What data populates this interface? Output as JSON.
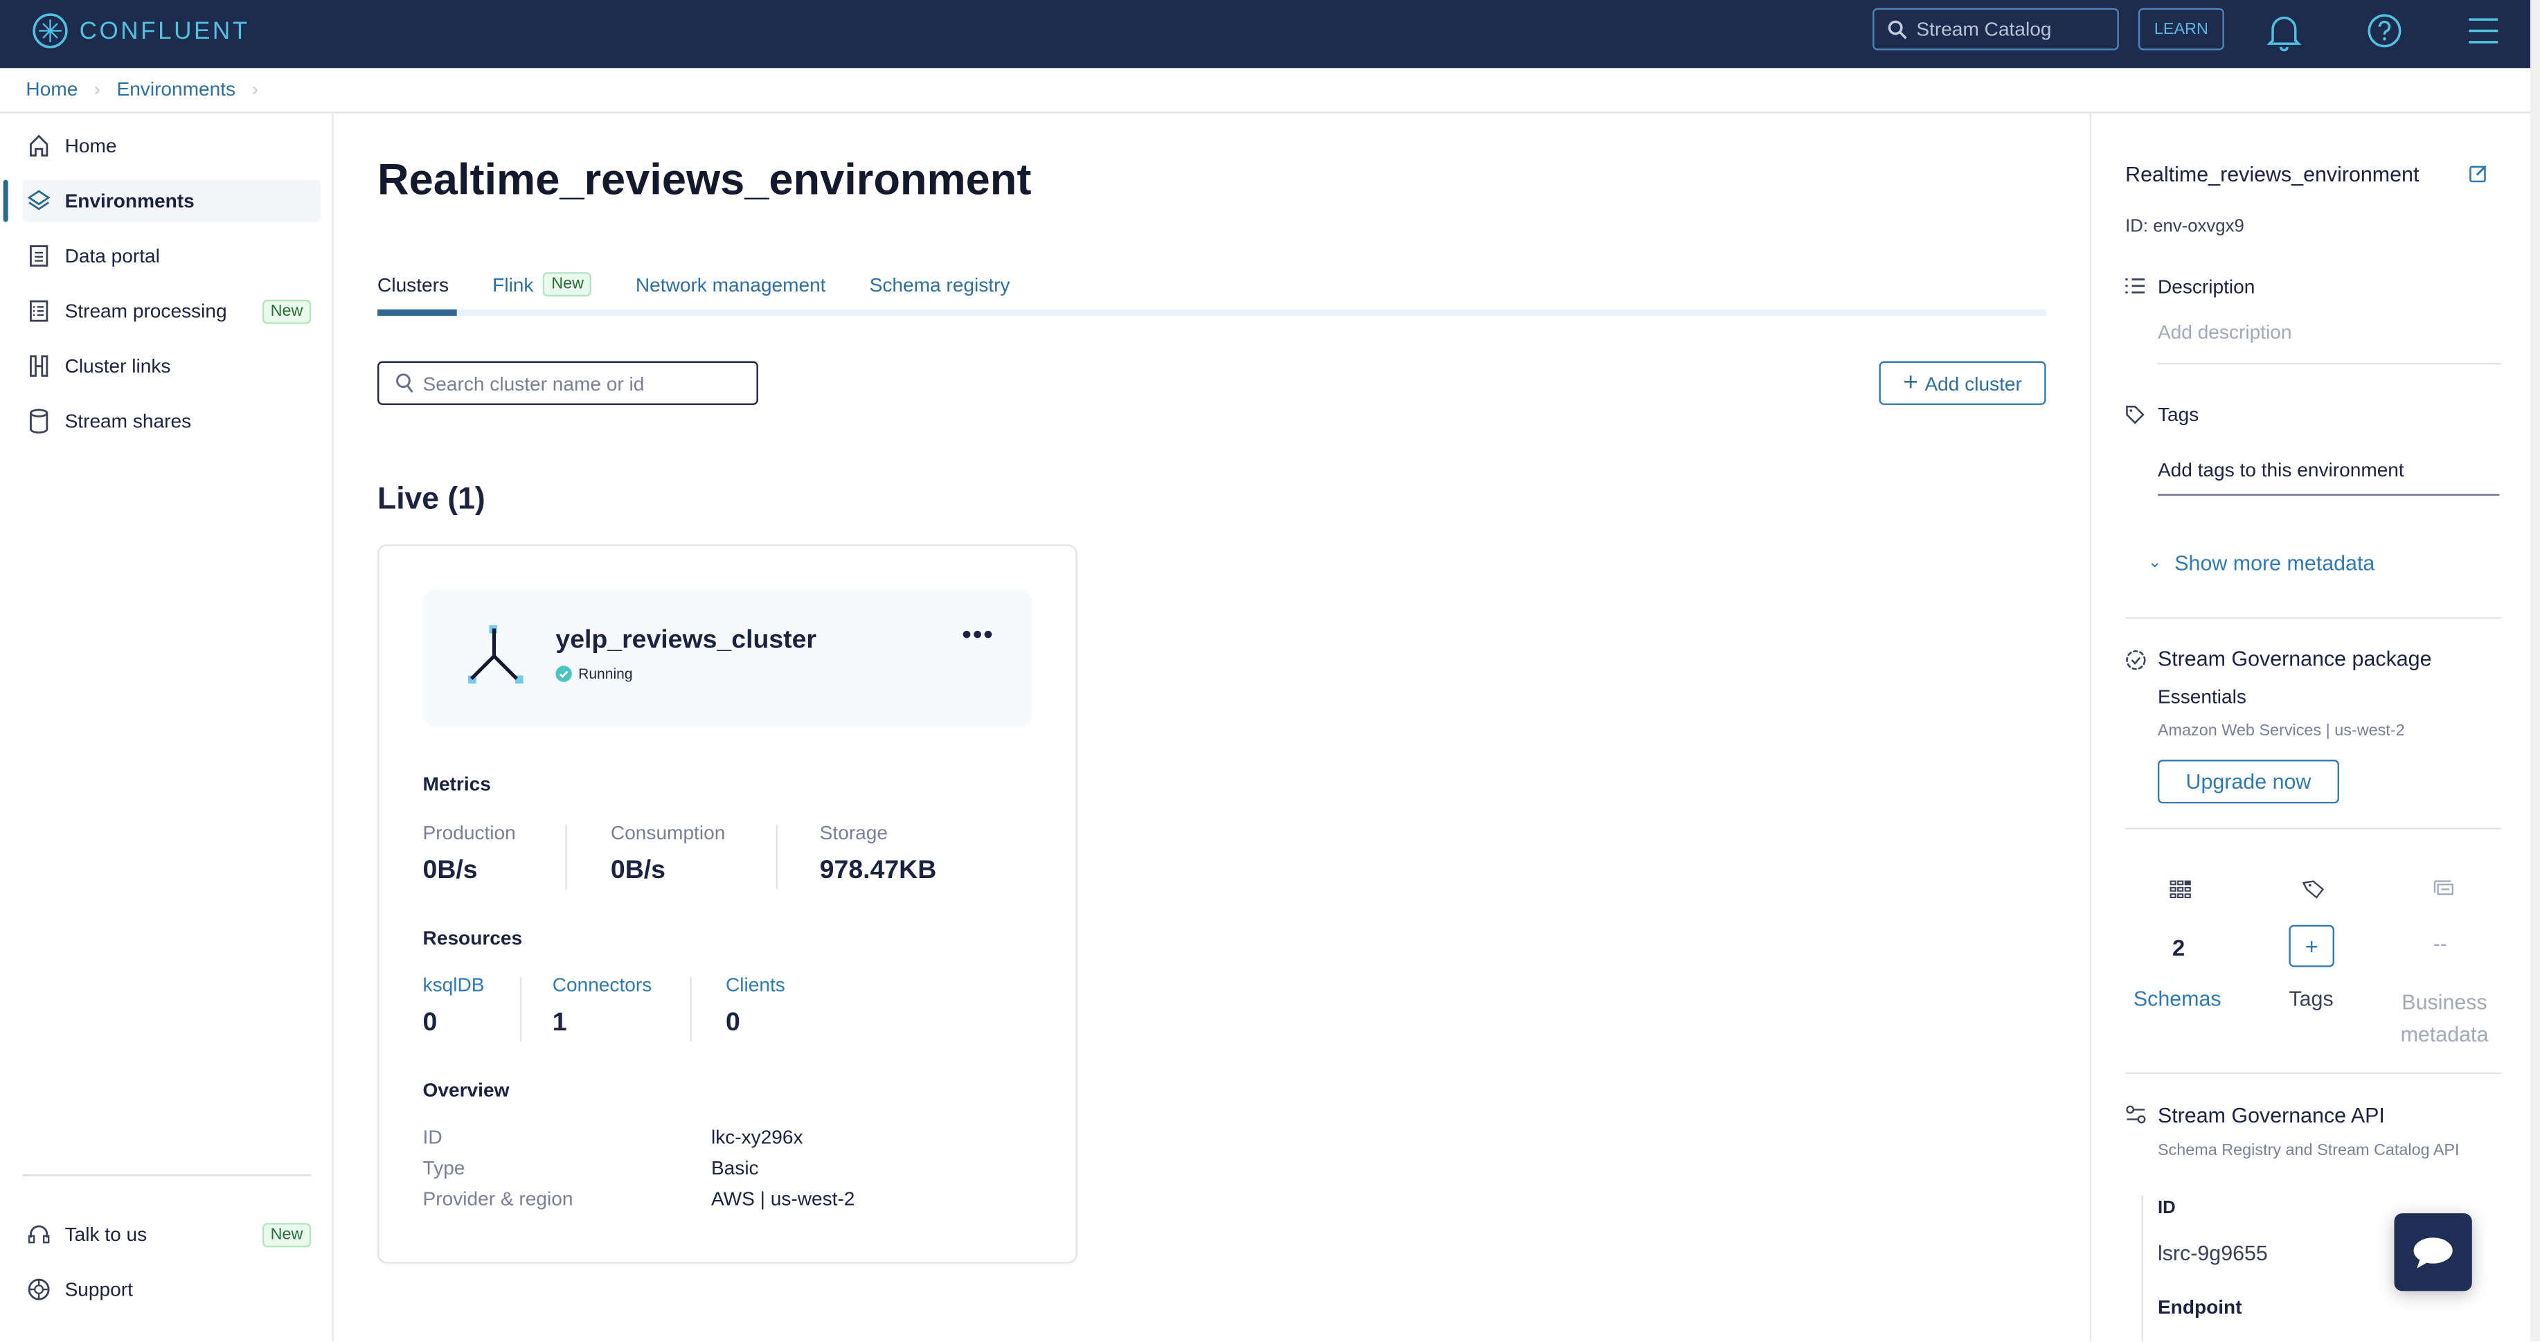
{
  "header": {
    "brand": "CONFLUENT",
    "search_placeholder": "Stream Catalog",
    "learn": "LEARN"
  },
  "breadcrumb": [
    "Home",
    "Environments"
  ],
  "sidebar": {
    "items": [
      {
        "label": "Home",
        "icon": "home-icon"
      },
      {
        "label": "Environments",
        "icon": "layers-icon",
        "active": true
      },
      {
        "label": "Data portal",
        "icon": "document-icon"
      },
      {
        "label": "Stream processing",
        "icon": "list-icon",
        "badge": "New"
      },
      {
        "label": "Cluster links",
        "icon": "link-icon"
      },
      {
        "label": "Stream shares",
        "icon": "cylinder-icon"
      }
    ],
    "bottom": [
      {
        "label": "Talk to us",
        "icon": "headset-icon",
        "badge": "New"
      },
      {
        "label": "Support",
        "icon": "lifebuoy-icon"
      }
    ]
  },
  "main": {
    "title": "Realtime_reviews_environment",
    "tabs": [
      {
        "label": "Clusters",
        "active": true
      },
      {
        "label": "Flink",
        "badge": "New"
      },
      {
        "label": "Network management"
      },
      {
        "label": "Schema registry"
      }
    ],
    "search_placeholder": "Search cluster name or id",
    "add_cluster": "Add cluster",
    "live_heading": "Live (1)",
    "cluster": {
      "name": "yelp_reviews_cluster",
      "status": "Running",
      "status_color": "#4cc3c0",
      "metrics_heading": "Metrics",
      "metrics": [
        {
          "label": "Production",
          "value": "0B/s"
        },
        {
          "label": "Consumption",
          "value": "0B/s"
        },
        {
          "label": "Storage",
          "value": "978.47KB"
        }
      ],
      "resources_heading": "Resources",
      "resources": [
        {
          "label": "ksqlDB",
          "value": "0"
        },
        {
          "label": "Connectors",
          "value": "1"
        },
        {
          "label": "Clients",
          "value": "0"
        }
      ],
      "overview_heading": "Overview",
      "overview": [
        {
          "label": "ID",
          "value": "lkc-xy296x"
        },
        {
          "label": "Type",
          "value": "Basic"
        },
        {
          "label": "Provider & region",
          "value": "AWS | us-west-2"
        }
      ]
    }
  },
  "right_panel": {
    "title": "Realtime_reviews_environment",
    "id": "ID: env-oxvgx9",
    "description_label": "Description",
    "description_placeholder": "Add description",
    "tags_label": "Tags",
    "tags_placeholder": "Add tags to this environment",
    "show_more": "Show more metadata",
    "governance": {
      "title": "Stream Governance package",
      "tier": "Essentials",
      "provider": "Amazon Web Services | us-west-2",
      "upgrade": "Upgrade now"
    },
    "stats": [
      {
        "value": "2",
        "label": "Schemas"
      },
      {
        "value": "+",
        "label": "Tags"
      },
      {
        "value": "--",
        "label": "Business metadata"
      }
    ],
    "api": {
      "title": "Stream Governance API",
      "subtitle": "Schema Registry and Stream Catalog API",
      "id_label": "ID",
      "id_value": "lsrc-9g9655",
      "endpoint_label": "Endpoint"
    }
  },
  "colors": {
    "header_bg": "#1c2b4e",
    "accent": "#2f7ab0",
    "brand": "#53c0dd"
  }
}
